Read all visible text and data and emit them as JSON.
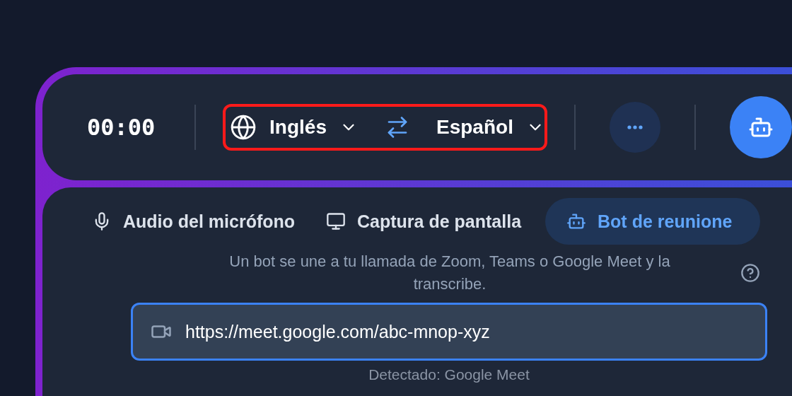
{
  "top_bar": {
    "timer": "00:00",
    "language_selector": {
      "highlighted": true,
      "source": "Inglés",
      "target": "Español"
    }
  },
  "source_tabs": [
    {
      "label": "Audio del micrófono",
      "kind": "mic",
      "selected": false
    },
    {
      "label": "Captura de pantalla",
      "kind": "screen",
      "selected": false
    },
    {
      "label": "Bot de reunione",
      "kind": "bot",
      "selected": true
    }
  ],
  "description": "Un bot se une a tu llamada de Zoom, Teams o Google Meet y la transcribe.",
  "meeting_link": {
    "value": "https://meet.google.com/abc-mnop-xyz"
  },
  "detected": "Detectado: Google Meet"
}
